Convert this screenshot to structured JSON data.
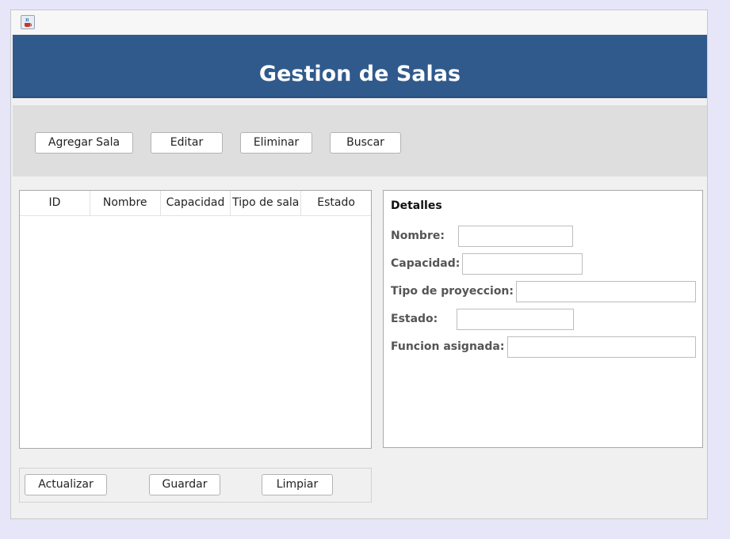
{
  "window": {
    "icon": "java-cup-icon",
    "banner_title": "Gestion de Salas"
  },
  "toolbar": {
    "add_label": "Agregar Sala",
    "edit_label": "Editar",
    "delete_label": "Eliminar",
    "search_label": "Buscar"
  },
  "table": {
    "columns": [
      "ID",
      "Nombre",
      "Capacidad",
      "Tipo de sala",
      "Estado"
    ],
    "rows": []
  },
  "details": {
    "title": "Detalles",
    "fields": [
      {
        "label": "Nombre:",
        "value": ""
      },
      {
        "label": "Capacidad:",
        "value": ""
      },
      {
        "label": "Tipo de proyeccion:",
        "value": ""
      },
      {
        "label": "Estado:",
        "value": ""
      },
      {
        "label": "Funcion asignada:",
        "value": ""
      }
    ]
  },
  "actions": {
    "refresh_label": "Actualizar",
    "save_label": "Guardar",
    "clear_label": "Limpiar"
  },
  "colors": {
    "banner": "#305a8c",
    "toolbar": "#dedede",
    "window": "#f0f0f0"
  }
}
